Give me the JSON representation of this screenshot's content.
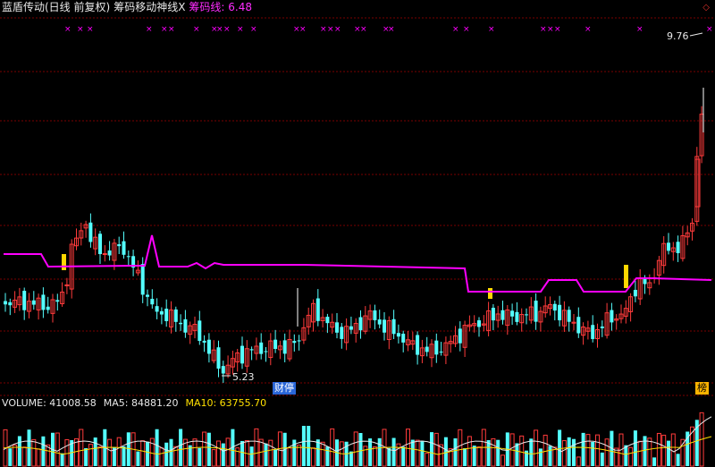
{
  "header": {
    "stock_title": "蓝盾传动(日线 前复权)",
    "indicator_name": "筹码移动神线X",
    "indicator_value_label": "筹码线: 6.48",
    "diamond_icon": "diamond-icon"
  },
  "volume_header": {
    "volume_label": "VOLUME: 41008.58",
    "ma5_label": "MA5: 84881.20",
    "ma10_label": "MA10: 63755.70"
  },
  "annotations": {
    "high_label": "9.76",
    "low_label": "5.23",
    "finance_tag": "财停",
    "list_tag": "榜"
  },
  "colors": {
    "up": "#ff3b3b",
    "down": "#54ffff",
    "chip_line": "#ff00ff",
    "marker": "#ff00ff",
    "highlight": "#ffd700",
    "grid": "#7a0000"
  },
  "chart_data": {
    "type": "candlestick",
    "price_range": [
      5.0,
      10.0
    ],
    "high": 9.76,
    "low": 5.23,
    "chip_line_last": 6.48
  }
}
